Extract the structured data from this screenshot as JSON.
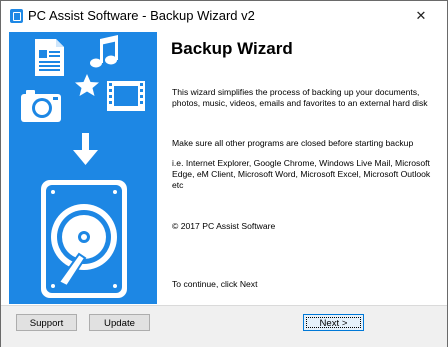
{
  "window": {
    "title": "PC Assist Software - Backup Wizard v2",
    "close_glyph": "✕"
  },
  "sidebar": {
    "icons": [
      "document-icon",
      "music-icon",
      "star-icon",
      "camera-icon",
      "film-icon",
      "arrow-down-icon",
      "hard-drive-icon"
    ],
    "accent": "#1d87e4"
  },
  "main": {
    "heading": "Backup Wizard",
    "intro": "This wizard simplifies the process of backing up your documents, photos, music, videos, emails and favorites to an external hard disk",
    "notice": "Make sure all other programs are closed before starting backup",
    "examples": "i.e. Internet Explorer, Google Chrome, Windows Live Mail, Microsoft Edge, eM Client, Microsoft Word, Microsoft Excel, Microsoft Outlook etc",
    "copyright": "© 2017 PC Assist Software",
    "continue": "To continue, click Next"
  },
  "footer": {
    "support_label": "Support",
    "update_label": "Update",
    "next_label": "Next >"
  }
}
